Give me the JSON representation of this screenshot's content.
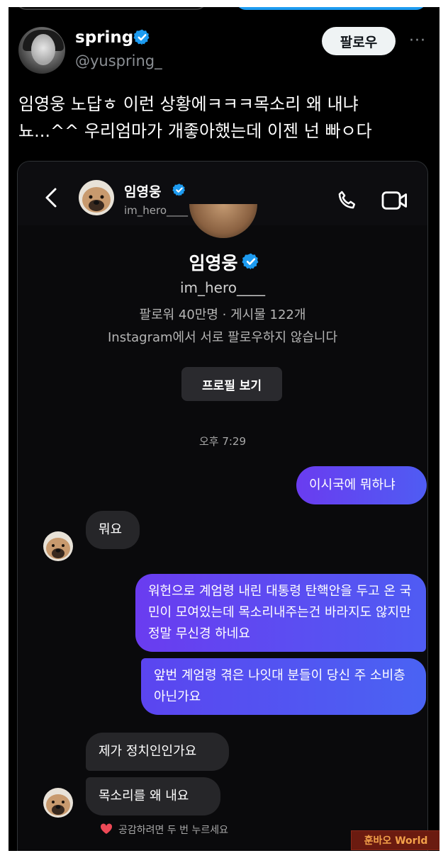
{
  "tweet": {
    "display_name": "spring",
    "handle": "@yuspring_",
    "follow_label": "팔로우",
    "more_label": "···",
    "text": "임영웅 노답ㅎ 이런 상황에ㅋㅋㅋ목소리 왜 내냐\n뇨...^^ 우리엄마가 개좋아했는데 이젠 넌 빠ㅇ다",
    "colors": {
      "background": "#000000",
      "accent": "#1d9bf0",
      "text": "#ffffff",
      "muted": "#8b8f94"
    }
  },
  "instagram": {
    "header": {
      "name": "임영웅",
      "handle": "im_hero____",
      "icons": [
        "back-arrow-icon",
        "phone-icon",
        "video-camera-icon"
      ]
    },
    "profile": {
      "name": "임영웅",
      "handle": "im_hero____",
      "stats": "팔로워 40만명 · 게시물 122개",
      "follow_note": "Instagram에서 서로 팔로우하지 않습니다",
      "view_profile_label": "프로필 보기"
    },
    "timestamp": "오후 7:29",
    "messages": [
      {
        "from": "me",
        "text": "이시국에 뭐하냐"
      },
      {
        "from": "them",
        "text": "뭐요"
      },
      {
        "from": "me",
        "text": "워헌으로 계엄령 내린 대통령 탄핵안을 두고 온 국민이 모여있는데 목소리내주는건 바라지도 않지만 정말 무신경 하네요"
      },
      {
        "from": "me",
        "text": "앞번 계엄령 겪은 나잇대 분들이 당신 주 소비층 아닌가요"
      },
      {
        "from": "them",
        "text": "제가 정치인인가요"
      },
      {
        "from": "them",
        "text": "목소리를 왜 내요"
      }
    ],
    "react_hint": "공감하려면 두 번 누르세요",
    "colors": {
      "sent_start": "#6a3cf0",
      "sent_end": "#4f5cf3",
      "received": "#262629"
    }
  },
  "watermark": {
    "text": "훈바오 World"
  }
}
